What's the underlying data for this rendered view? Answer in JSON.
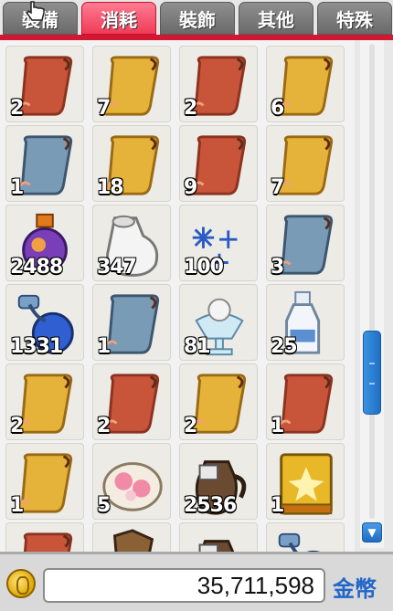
{
  "tabs": [
    {
      "label": "裝備",
      "active": false
    },
    {
      "label": "消耗",
      "active": true
    },
    {
      "label": "裝飾",
      "active": false
    },
    {
      "label": "其他",
      "active": false
    },
    {
      "label": "特殊",
      "active": false
    }
  ],
  "inventory": {
    "slots": [
      {
        "icon": "red-scroll-icon",
        "qty": "2"
      },
      {
        "icon": "gold-scroll-icon",
        "qty": "7"
      },
      {
        "icon": "red-scroll-icon",
        "qty": "2"
      },
      {
        "icon": "gold-scroll-icon",
        "qty": "6"
      },
      {
        "icon": "blue-scroll-icon",
        "qty": "1"
      },
      {
        "icon": "gold-scroll-icon",
        "qty": "18"
      },
      {
        "icon": "red-scroll-icon",
        "qty": "9"
      },
      {
        "icon": "gold-scroll-icon",
        "qty": "7"
      },
      {
        "icon": "orange-potion-icon",
        "qty": "2488"
      },
      {
        "icon": "white-potion-bag-icon",
        "qty": "347"
      },
      {
        "icon": "snowflake-icon",
        "qty": "100"
      },
      {
        "icon": "blue-scroll-icon",
        "qty": "3"
      },
      {
        "icon": "blue-potion-icon",
        "qty": "1331"
      },
      {
        "icon": "blue-scroll-icon",
        "qty": "1"
      },
      {
        "icon": "ice-cream-icon",
        "qty": "81"
      },
      {
        "icon": "milk-bottle-icon",
        "qty": "25"
      },
      {
        "icon": "gold-scroll-icon",
        "qty": "2"
      },
      {
        "icon": "red-scroll-icon",
        "qty": "2"
      },
      {
        "icon": "gold-scroll-icon",
        "qty": "2"
      },
      {
        "icon": "red-scroll-icon",
        "qty": "1"
      },
      {
        "icon": "gold-scroll-icon",
        "qty": "1"
      },
      {
        "icon": "pink-cake-icon",
        "qty": "5"
      },
      {
        "icon": "jug-icon",
        "qty": "2536"
      },
      {
        "icon": "gold-book-icon",
        "qty": "1"
      },
      {
        "icon": "red-scroll-icon",
        "qty": ""
      },
      {
        "icon": "brown-item-icon",
        "qty": ""
      },
      {
        "icon": "jug-icon",
        "qty": ""
      },
      {
        "icon": "blue-potion-icon",
        "qty": ""
      }
    ]
  },
  "money": {
    "value": "35,711,598",
    "label": "金幣"
  },
  "colors": {
    "active_tab": "#f03a58",
    "tab_line": "#d11731",
    "scroll_thumb": "#2a7fd4",
    "money_label": "#2366c9"
  }
}
